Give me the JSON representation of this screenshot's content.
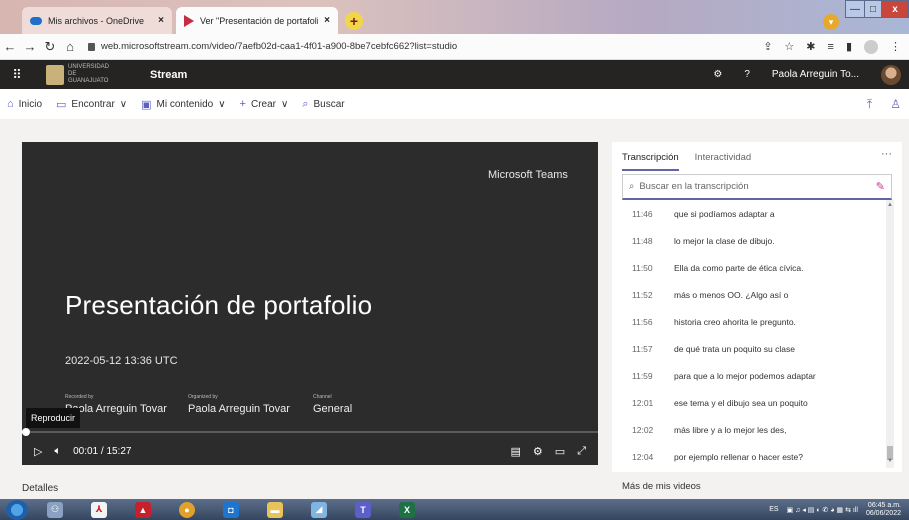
{
  "browser": {
    "tabs": [
      {
        "title": "Mis archivos - OneDrive",
        "active": false
      },
      {
        "title": "Ver \"Presentación de portafolio-",
        "active": true
      }
    ],
    "new_tab": "+",
    "tab_close": "×",
    "url": "web.microsoftstream.com/video/7aefb02d-caa1-4f01-a900-8be7cebfc662?list=studio",
    "window": {
      "min": "—",
      "max": "□",
      "close": "x"
    }
  },
  "stream_header": {
    "org_name": "UNIVERSIDAD DE GUANAJUATO",
    "app_name": "Stream",
    "user_name": "Paola Arreguin To...",
    "help": "?"
  },
  "nav": {
    "home": "Inicio",
    "discover": "Encontrar",
    "my_content": "Mi contenido",
    "create": "Crear",
    "search": "Buscar"
  },
  "player": {
    "watermark": "Microsoft Teams",
    "title": "Presentación de portafolio",
    "date": "2022-05-12 13:36 UTC",
    "recorded_by_label": "Recorded by",
    "recorded_by": "Paola Arreguin Tovar",
    "organized_by_label": "Organized by",
    "organized_by": "Paola Arreguin Tovar",
    "channel_label": "Channel",
    "channel": "General",
    "tooltip": "Reproducir",
    "time": "00:01 / 15:27",
    "progress": 0.001
  },
  "details_label": "Detalles",
  "transcript": {
    "tab_transcript": "Transcripción",
    "tab_interactivity": "Interactividad",
    "more": "···",
    "search_placeholder": "Buscar en la transcripción",
    "rows": [
      {
        "time": "11:46",
        "text": "que si podíamos adaptar a"
      },
      {
        "time": "11:48",
        "text": "lo mejor la clase de dibujo."
      },
      {
        "time": "11:50",
        "text": "Ella da como parte de ética cívica."
      },
      {
        "time": "11:52",
        "text": "más o menos OO. ¿Algo así o"
      },
      {
        "time": "11:56",
        "text": "historia creo ahorita le pregunto."
      },
      {
        "time": "11:57",
        "text": "de qué trata un poquito su clase"
      },
      {
        "time": "11:59",
        "text": "para que a lo mejor podemos adaptar"
      },
      {
        "time": "12:01",
        "text": "ese tema y el dibujo sea un poquito"
      },
      {
        "time": "12:02",
        "text": "más libre y a lo mejor les des,"
      },
      {
        "time": "12:04",
        "text": "por ejemplo rellenar o hacer este?"
      }
    ]
  },
  "more_videos_label": "Más de mis videos",
  "taskbar": {
    "lang": "ES",
    "time": "06:45 a.m.",
    "date": "06/06/2022"
  },
  "colors": {
    "accent": "#6264a7",
    "header_bg": "#252423",
    "player_bg": "#2d2c2c"
  }
}
